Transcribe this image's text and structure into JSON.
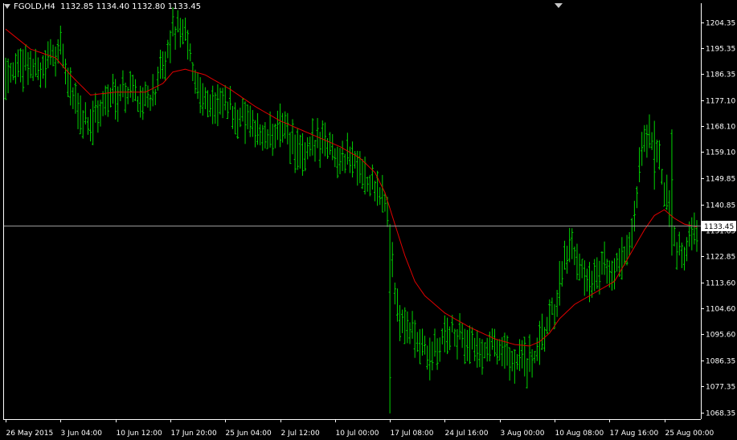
{
  "header": {
    "symbol": "FGOLD,H4",
    "ohlc": "1132.85 1134.40 1132.80 1133.45"
  },
  "colors": {
    "background": "#000000",
    "bars": "#00d400",
    "moving_average": "#e00000",
    "axis": "#ffffff",
    "price_line": "#9a9a9a",
    "price_box": "#ffffff"
  },
  "chart_data": {
    "type": "ohlc",
    "title": "FGOLD,H4",
    "current_price": 1133.45,
    "current_price_label": "1133.45",
    "ylim": [
      1066,
      1211
    ],
    "y_ticks": [
      "1204.35",
      "1195.35",
      "1186.35",
      "1177.10",
      "1168.10",
      "1159.10",
      "1149.85",
      "1140.85",
      "1131.85",
      "1122.85",
      "1113.60",
      "1104.60",
      "1095.60",
      "1086.35",
      "1077.35",
      "1068.35"
    ],
    "x_labels": [
      "26 May 2015",
      "3 Jun 04:00",
      "10 Jun 12:00",
      "17 Jun 20:00",
      "25 Jun 04:00",
      "2 Jul 12:00",
      "10 Jul 00:00",
      "17 Jul 08:00",
      "24 Jul 16:00",
      "3 Aug 00:00",
      "10 Aug 08:00",
      "17 Aug 16:00",
      "25 Aug 00:00"
    ],
    "x_label_bars": [
      0,
      22,
      44,
      66,
      88,
      110,
      132,
      154,
      176,
      198,
      220,
      242,
      264
    ],
    "bar_count": 278,
    "price_path": [
      [
        0,
        1187
      ],
      [
        8,
        1190
      ],
      [
        15,
        1188
      ],
      [
        19,
        1193
      ],
      [
        22,
        1195
      ],
      [
        24,
        1186
      ],
      [
        27,
        1178
      ],
      [
        31,
        1171
      ],
      [
        34,
        1170
      ],
      [
        38,
        1174
      ],
      [
        42,
        1178
      ],
      [
        46,
        1180
      ],
      [
        50,
        1181
      ],
      [
        54,
        1178
      ],
      [
        57,
        1177
      ],
      [
        61,
        1182
      ],
      [
        64,
        1190
      ],
      [
        67,
        1201
      ],
      [
        70,
        1203
      ],
      [
        73,
        1196
      ],
      [
        76,
        1185
      ],
      [
        80,
        1177
      ],
      [
        84,
        1174
      ],
      [
        88,
        1176
      ],
      [
        92,
        1172
      ],
      [
        96,
        1170
      ],
      [
        100,
        1166
      ],
      [
        104,
        1164
      ],
      [
        108,
        1166
      ],
      [
        112,
        1168
      ],
      [
        116,
        1161
      ],
      [
        119,
        1156
      ],
      [
        122,
        1160
      ],
      [
        126,
        1164
      ],
      [
        129,
        1162
      ],
      [
        133,
        1159
      ],
      [
        136,
        1156
      ],
      [
        140,
        1157
      ],
      [
        143,
        1152
      ],
      [
        146,
        1147
      ],
      [
        149,
        1145
      ],
      [
        152,
        1143
      ],
      [
        154,
        1134
      ],
      [
        156,
        1112
      ],
      [
        158,
        1102
      ],
      [
        161,
        1098
      ],
      [
        163,
        1094
      ],
      [
        166,
        1092
      ],
      [
        170,
        1086
      ],
      [
        174,
        1092
      ],
      [
        177,
        1097
      ],
      [
        180,
        1096
      ],
      [
        183,
        1094
      ],
      [
        186,
        1093
      ],
      [
        190,
        1088
      ],
      [
        193,
        1092
      ],
      [
        196,
        1093
      ],
      [
        199,
        1090
      ],
      [
        202,
        1086
      ],
      [
        206,
        1088
      ],
      [
        209,
        1085
      ],
      [
        212,
        1088
      ],
      [
        215,
        1093
      ],
      [
        218,
        1100
      ],
      [
        221,
        1108
      ],
      [
        224,
        1119
      ],
      [
        227,
        1125
      ],
      [
        230,
        1118
      ],
      [
        234,
        1112
      ],
      [
        238,
        1118
      ],
      [
        241,
        1119
      ],
      [
        244,
        1117
      ],
      [
        247,
        1120
      ],
      [
        251,
        1132
      ],
      [
        253,
        1145
      ],
      [
        255,
        1160
      ],
      [
        258,
        1165
      ],
      [
        261,
        1158
      ],
      [
        263,
        1150
      ],
      [
        265,
        1143
      ],
      [
        267,
        1135
      ],
      [
        269,
        1128
      ],
      [
        271,
        1124
      ],
      [
        273,
        1126
      ],
      [
        275,
        1130
      ],
      [
        277,
        1133.45
      ]
    ],
    "ma_path": [
      [
        0,
        1202
      ],
      [
        10,
        1195
      ],
      [
        20,
        1192
      ],
      [
        26,
        1186
      ],
      [
        34,
        1179
      ],
      [
        44,
        1180
      ],
      [
        56,
        1180
      ],
      [
        63,
        1183
      ],
      [
        67,
        1187
      ],
      [
        72,
        1188
      ],
      [
        80,
        1186
      ],
      [
        90,
        1181
      ],
      [
        100,
        1175
      ],
      [
        110,
        1170
      ],
      [
        118,
        1167
      ],
      [
        126,
        1164
      ],
      [
        134,
        1161
      ],
      [
        142,
        1157
      ],
      [
        148,
        1152
      ],
      [
        152,
        1145
      ],
      [
        156,
        1134
      ],
      [
        160,
        1123
      ],
      [
        164,
        1114
      ],
      [
        168,
        1109
      ],
      [
        176,
        1103
      ],
      [
        186,
        1098
      ],
      [
        196,
        1094
      ],
      [
        204,
        1092
      ],
      [
        210,
        1091.5
      ],
      [
        214,
        1093
      ],
      [
        218,
        1096
      ],
      [
        222,
        1101
      ],
      [
        228,
        1106
      ],
      [
        236,
        1110
      ],
      [
        244,
        1114
      ],
      [
        248,
        1120
      ],
      [
        252,
        1126
      ],
      [
        256,
        1132
      ],
      [
        260,
        1137
      ],
      [
        264,
        1139
      ],
      [
        268,
        1136
      ],
      [
        272,
        1134
      ],
      [
        277,
        1133
      ]
    ]
  }
}
